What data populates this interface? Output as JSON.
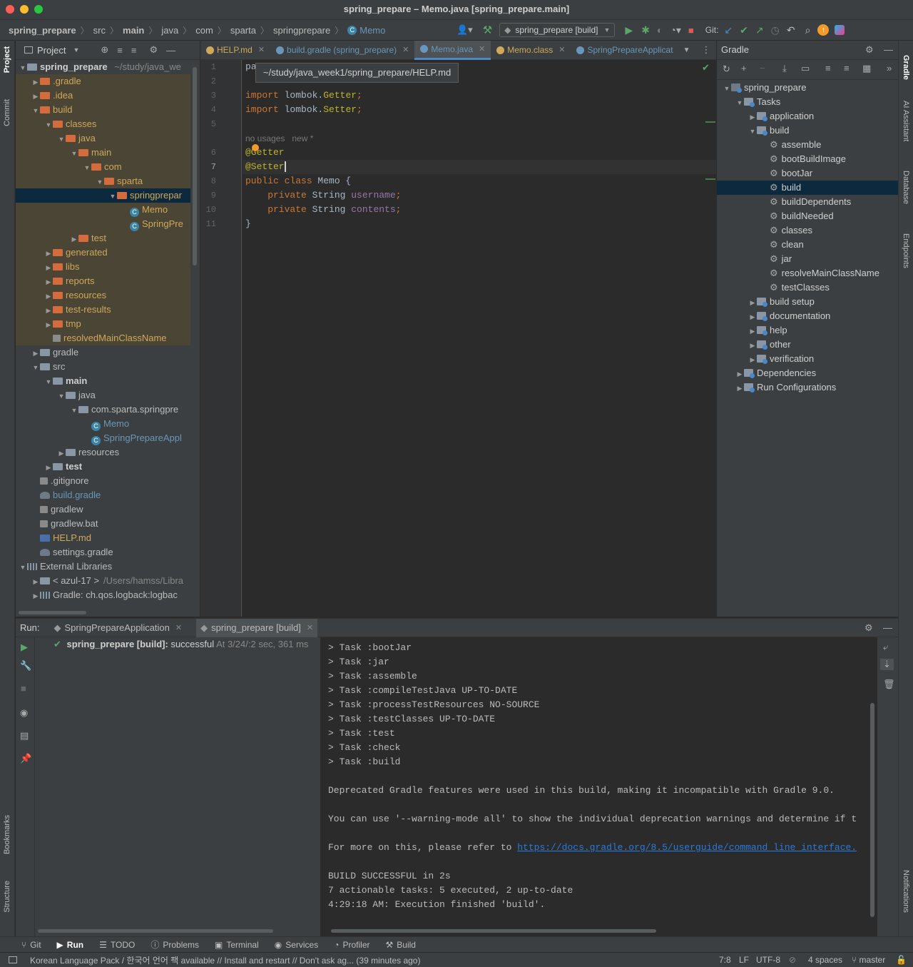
{
  "window": {
    "title": "spring_prepare – Memo.java [spring_prepare.main]"
  },
  "breadcrumbs": [
    "spring_prepare",
    "src",
    "main",
    "java",
    "com",
    "sparta",
    "springprepare",
    "Memo"
  ],
  "toolbar": {
    "run_config": "spring_prepare [build]",
    "git_label": "Git:"
  },
  "left_strip": {
    "project": "Project",
    "commit": "Commit",
    "bookmarks": "Bookmarks",
    "structure": "Structure"
  },
  "right_strip": {
    "gradle": "Gradle",
    "ai": "AI Assistant",
    "database": "Database",
    "endpoints": "Endpoints",
    "notifications": "Notifications"
  },
  "project": {
    "header": "Project",
    "root": {
      "name": "spring_prepare",
      "path": "~/study/java_we"
    },
    "items": [
      {
        "label": ".gradle",
        "depth": 1,
        "type": "folder-o",
        "arrow": "right",
        "style": "orange",
        "ex": true
      },
      {
        "label": ".idea",
        "depth": 1,
        "type": "folder-o",
        "arrow": "right",
        "style": "orange",
        "ex": true
      },
      {
        "label": "build",
        "depth": 1,
        "type": "folder-o",
        "arrow": "down",
        "style": "orange",
        "ex": true
      },
      {
        "label": "classes",
        "depth": 2,
        "type": "folder-o",
        "arrow": "down",
        "style": "orange",
        "ex": true
      },
      {
        "label": "java",
        "depth": 3,
        "type": "folder-o",
        "arrow": "down",
        "style": "orange",
        "ex": true
      },
      {
        "label": "main",
        "depth": 4,
        "type": "folder-o",
        "arrow": "down",
        "style": "orange",
        "ex": true
      },
      {
        "label": "com",
        "depth": 5,
        "type": "folder-o",
        "arrow": "down",
        "style": "orange",
        "ex": true
      },
      {
        "label": "sparta",
        "depth": 6,
        "type": "folder-o",
        "arrow": "down",
        "style": "orange",
        "ex": true
      },
      {
        "label": "springprepar",
        "depth": 7,
        "type": "folder-o",
        "arrow": "down",
        "style": "orange",
        "sel": true
      },
      {
        "label": "Memo",
        "depth": 8,
        "type": "class",
        "arrow": "",
        "style": "orange",
        "ex": true
      },
      {
        "label": "SpringPre",
        "depth": 8,
        "type": "class",
        "arrow": "",
        "style": "orange",
        "ex": true
      },
      {
        "label": "test",
        "depth": 4,
        "type": "folder-o",
        "arrow": "right",
        "style": "orange",
        "ex": true
      },
      {
        "label": "generated",
        "depth": 2,
        "type": "folder-o",
        "arrow": "right",
        "style": "orange",
        "ex": true
      },
      {
        "label": "libs",
        "depth": 2,
        "type": "folder-o",
        "arrow": "right",
        "style": "orange",
        "ex": true
      },
      {
        "label": "reports",
        "depth": 2,
        "type": "folder-o",
        "arrow": "right",
        "style": "orange",
        "ex": true
      },
      {
        "label": "resources",
        "depth": 2,
        "type": "folder-o",
        "arrow": "right",
        "style": "orange",
        "ex": true
      },
      {
        "label": "test-results",
        "depth": 2,
        "type": "folder-o",
        "arrow": "right",
        "style": "orange",
        "ex": true
      },
      {
        "label": "tmp",
        "depth": 2,
        "type": "folder-o",
        "arrow": "right",
        "style": "orange",
        "ex": true
      },
      {
        "label": "resolvedMainClassName",
        "depth": 2,
        "type": "file",
        "arrow": "",
        "style": "orange",
        "ex": true
      },
      {
        "label": "gradle",
        "depth": 1,
        "type": "folder-b",
        "arrow": "right",
        "style": ""
      },
      {
        "label": "src",
        "depth": 1,
        "type": "folder-b",
        "arrow": "down",
        "style": ""
      },
      {
        "label": "main",
        "depth": 2,
        "type": "folder-b",
        "arrow": "down",
        "style": "bold"
      },
      {
        "label": "java",
        "depth": 3,
        "type": "folder-b",
        "arrow": "down",
        "style": ""
      },
      {
        "label": "com.sparta.springpre",
        "depth": 4,
        "type": "folder-b",
        "arrow": "down",
        "style": ""
      },
      {
        "label": "Memo",
        "depth": 5,
        "type": "class",
        "arrow": "",
        "style": "blue"
      },
      {
        "label": "SpringPrepareAppl",
        "depth": 5,
        "type": "class",
        "arrow": "",
        "style": "blue"
      },
      {
        "label": "resources",
        "depth": 3,
        "type": "folder-b",
        "arrow": "right",
        "style": ""
      },
      {
        "label": "test",
        "depth": 2,
        "type": "folder-b",
        "arrow": "right",
        "style": "bold"
      },
      {
        "label": ".gitignore",
        "depth": 1,
        "type": "file",
        "arrow": "",
        "style": ""
      },
      {
        "label": "build.gradle",
        "depth": 1,
        "type": "gradle",
        "arrow": "",
        "style": "blue"
      },
      {
        "label": "gradlew",
        "depth": 1,
        "type": "file",
        "arrow": "",
        "style": ""
      },
      {
        "label": "gradlew.bat",
        "depth": 1,
        "type": "file",
        "arrow": "",
        "style": ""
      },
      {
        "label": "HELP.md",
        "depth": 1,
        "type": "md",
        "arrow": "",
        "style": "orange"
      },
      {
        "label": "settings.gradle",
        "depth": 1,
        "type": "gradle",
        "arrow": "",
        "style": ""
      },
      {
        "label": "External Libraries",
        "depth": 0,
        "type": "lib",
        "arrow": "down",
        "style": ""
      },
      {
        "label": "< azul-17 >",
        "extra": "/Users/hamss/Libra",
        "depth": 1,
        "type": "folder-b",
        "arrow": "right",
        "style": ""
      },
      {
        "label": "Gradle: ch.qos.logback:logbac",
        "depth": 1,
        "type": "lib",
        "arrow": "right",
        "style": ""
      }
    ]
  },
  "editor": {
    "tabs": [
      {
        "label": "HELP.md",
        "color": "#d0a85a"
      },
      {
        "label": "build.gradle (spring_prepare)",
        "color": "#6897bb"
      },
      {
        "label": "Memo.java",
        "color": "#6897bb",
        "active": true
      },
      {
        "label": "Memo.class",
        "color": "#d0a85a"
      },
      {
        "label": "SpringPrepareApplicat",
        "color": "#6897bb"
      }
    ],
    "tooltip": "~/study/java_week1/spring_prepare/HELP.md",
    "hint": "no usages   new *",
    "line_numbers": [
      "1",
      "2",
      "3",
      "4",
      "5",
      "6",
      "7",
      "8",
      "9",
      "10",
      "11"
    ],
    "lines": {
      "l1": "pa",
      "l3": [
        "import",
        " lombok.",
        "Getter",
        ";"
      ],
      "l4": [
        "import",
        " lombok.",
        "Setter",
        ";"
      ],
      "l6": "@Getter",
      "l7": "@Setter",
      "l8": [
        "public class",
        " Memo {"
      ],
      "l9": [
        "    private",
        " String ",
        "username",
        ";"
      ],
      "l10": [
        "    private",
        " String ",
        "contents",
        ";"
      ],
      "l11": "}"
    }
  },
  "gradle": {
    "header": "Gradle",
    "items": [
      {
        "label": "spring_prepare",
        "depth": 0,
        "arrow": "down",
        "icon": "proj"
      },
      {
        "label": "Tasks",
        "depth": 1,
        "arrow": "down",
        "icon": "grp"
      },
      {
        "label": "application",
        "depth": 2,
        "arrow": "right",
        "icon": "grp"
      },
      {
        "label": "build",
        "depth": 2,
        "arrow": "down",
        "icon": "grp"
      },
      {
        "label": "assemble",
        "depth": 3,
        "arrow": "",
        "icon": "gear"
      },
      {
        "label": "bootBuildImage",
        "depth": 3,
        "arrow": "",
        "icon": "gear"
      },
      {
        "label": "bootJar",
        "depth": 3,
        "arrow": "",
        "icon": "gear"
      },
      {
        "label": "build",
        "depth": 3,
        "arrow": "",
        "icon": "gear",
        "sel": true
      },
      {
        "label": "buildDependents",
        "depth": 3,
        "arrow": "",
        "icon": "gear"
      },
      {
        "label": "buildNeeded",
        "depth": 3,
        "arrow": "",
        "icon": "gear"
      },
      {
        "label": "classes",
        "depth": 3,
        "arrow": "",
        "icon": "gear"
      },
      {
        "label": "clean",
        "depth": 3,
        "arrow": "",
        "icon": "gear"
      },
      {
        "label": "jar",
        "depth": 3,
        "arrow": "",
        "icon": "gear"
      },
      {
        "label": "resolveMainClassName",
        "depth": 3,
        "arrow": "",
        "icon": "gear"
      },
      {
        "label": "testClasses",
        "depth": 3,
        "arrow": "",
        "icon": "gear"
      },
      {
        "label": "build setup",
        "depth": 2,
        "arrow": "right",
        "icon": "grp"
      },
      {
        "label": "documentation",
        "depth": 2,
        "arrow": "right",
        "icon": "grp"
      },
      {
        "label": "help",
        "depth": 2,
        "arrow": "right",
        "icon": "grp"
      },
      {
        "label": "other",
        "depth": 2,
        "arrow": "right",
        "icon": "grp"
      },
      {
        "label": "verification",
        "depth": 2,
        "arrow": "right",
        "icon": "grp"
      },
      {
        "label": "Dependencies",
        "depth": 1,
        "arrow": "right",
        "icon": "lib"
      },
      {
        "label": "Run Configurations",
        "depth": 1,
        "arrow": "right",
        "icon": "lib"
      }
    ]
  },
  "run": {
    "label": "Run:",
    "tabs": [
      "SpringPrepareApplication",
      "spring_prepare [build]"
    ],
    "result": {
      "name": "spring_prepare [build]:",
      "status": "successful",
      "time": "At 3/24/:",
      "duration": "2 sec, 361 ms"
    },
    "console": [
      "> Task :bootJar",
      "> Task :jar",
      "> Task :assemble",
      "> Task :compileTestJava UP-TO-DATE",
      "> Task :processTestResources NO-SOURCE",
      "> Task :testClasses UP-TO-DATE",
      "> Task :test",
      "> Task :check",
      "> Task :build",
      "",
      "Deprecated Gradle features were used in this build, making it incompatible with Gradle 9.0.",
      "",
      "You can use '--warning-mode all' to show the individual deprecation warnings and determine if t",
      "",
      "",
      "",
      "BUILD SUCCESSFUL in 2s",
      "7 actionable tasks: 5 executed, 2 up-to-date",
      "4:29:18 AM: Execution finished 'build'."
    ],
    "refer_prefix": "For more on this, please refer to ",
    "refer_link": "https://docs.gradle.org/8.5/userguide/command_line_interface."
  },
  "bottom_tabs": [
    "Git",
    "Run",
    "TODO",
    "Problems",
    "Terminal",
    "Services",
    "Profiler",
    "Build"
  ],
  "status": {
    "message": "Korean Language Pack / 한국어 언어 팩 available // Install and restart // Don't ask ag... (39 minutes ago)",
    "position": "7:8",
    "line_sep": "LF",
    "encoding": "UTF-8",
    "indent": "4 spaces",
    "branch": "master"
  },
  "colors": {
    "accent": "#4a88c7",
    "success": "#59a869",
    "excluded": "#4a4534",
    "selection": "#0d293e"
  }
}
